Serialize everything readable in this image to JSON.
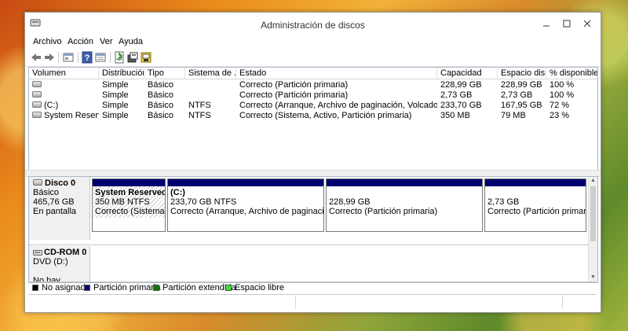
{
  "window": {
    "title": "Administración de discos"
  },
  "menu": [
    "Archivo",
    "Acción",
    "Ver",
    "Ayuda"
  ],
  "toolbar": {
    "icons": [
      "back-arrow-icon",
      "forward-arrow-icon",
      "properties-view-icon",
      "help-icon",
      "list-view-icon",
      "refresh-icon",
      "console-icon",
      "format-icon"
    ]
  },
  "volumes": {
    "headers": [
      "Volumen",
      "Distribución",
      "Tipo",
      "Sistema de ...",
      "Estado",
      "Capacidad",
      "Espacio dis...",
      "% disponible"
    ],
    "rows": [
      [
        "",
        "Simple",
        "Básico",
        "",
        "Correcto (Partición primaria)",
        "228,99 GB",
        "228,99 GB",
        "100 %"
      ],
      [
        "",
        "Simple",
        "Básico",
        "",
        "Correcto (Partición primaria)",
        "2,73 GB",
        "2,73 GB",
        "100 %"
      ],
      [
        "(C:)",
        "Simple",
        "Básico",
        "NTFS",
        "Correcto (Arranque, Archivo de paginación, Volcado, Partic...",
        "233,70 GB",
        "167,95 GB",
        "72 %"
      ],
      [
        "System Reserved",
        "Simple",
        "Básico",
        "NTFS",
        "Correcto (Sistema, Activo, Partición primaria)",
        "350 MB",
        "79 MB",
        "23 %"
      ]
    ]
  },
  "disk0": {
    "name": "Disco 0",
    "type": "Básico",
    "size": "465,76 GB",
    "status": "En pantalla",
    "partitions": [
      {
        "title": "System Reserved",
        "size": "350 MB NTFS",
        "status": "Correcto (Sistema, Ac"
      },
      {
        "title": "(C:)",
        "size": "233,70 GB NTFS",
        "status": "Correcto (Arranque, Archivo de paginación, Vol"
      },
      {
        "title": "",
        "size": "228,99 GB",
        "status": "Correcto (Partición primaria)"
      },
      {
        "title": "",
        "size": "2,73 GB",
        "status": "Correcto (Partición primaria)"
      }
    ]
  },
  "cdrom0": {
    "name": "CD-ROM 0",
    "drive": "DVD (D:)",
    "status": "No hay medios"
  },
  "legend": [
    {
      "label": "No asignado",
      "color": "#000000"
    },
    {
      "label": "Partición primaria",
      "color": "#00006f"
    },
    {
      "label": "Partición extendida",
      "color": "#007d00"
    },
    {
      "label": "Espacio libre",
      "color": "#3fe03f"
    }
  ]
}
